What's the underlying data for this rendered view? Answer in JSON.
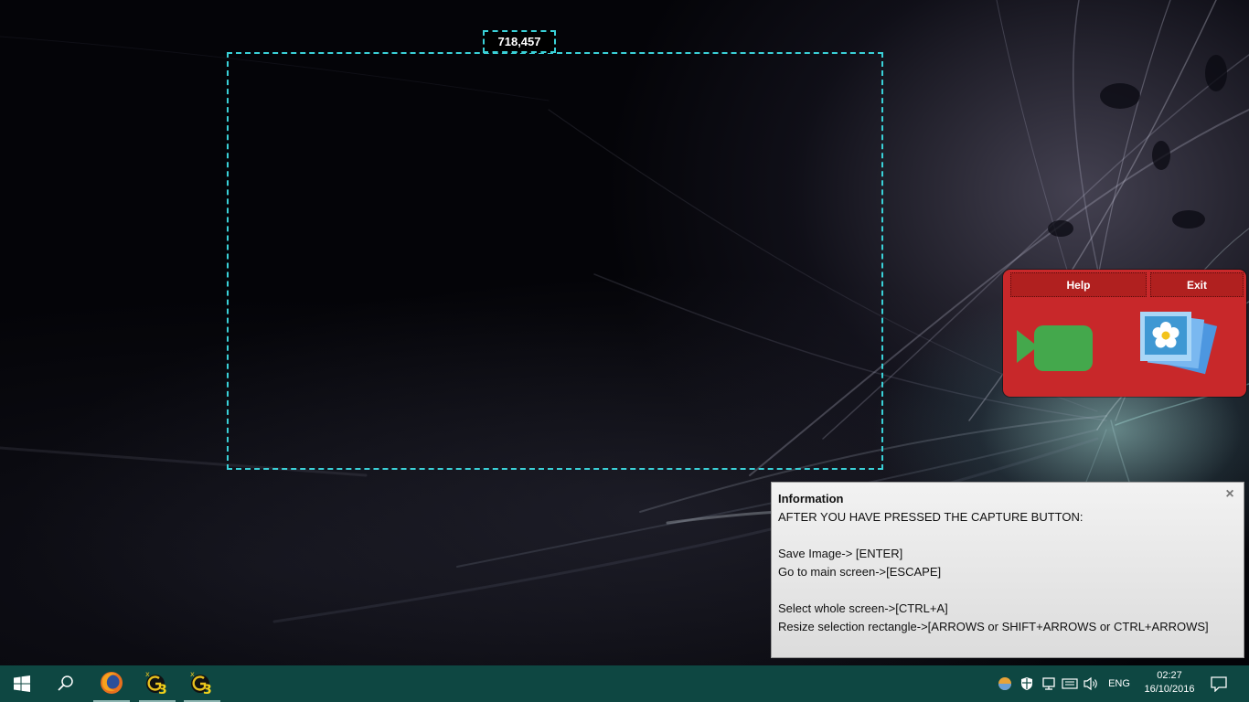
{
  "selection": {
    "size_label": "718,457",
    "border_color": "#3ad1d8"
  },
  "capture_panel": {
    "help_label": "Help",
    "exit_label": "Exit",
    "video_icon": "video-camera-icon",
    "image_icon": "image-gallery-icon",
    "background_color": "#c8282a"
  },
  "info_balloon": {
    "title": "Information",
    "close_icon": "close-icon",
    "lines": [
      "AFTER YOU HAVE PRESSED THE CAPTURE BUTTON:",
      "",
      "Save Image-> [ENTER]",
      "Go to main screen->[ESCAPE]",
      "",
      "Select whole screen->[CTRL+A]",
      "Resize selection rectangle->[ARROWS or SHIFT+ARROWS or CTRL+ARROWS]"
    ]
  },
  "taskbar": {
    "background_color": "#0e4742",
    "apps": [
      {
        "icon": "firefox-icon"
      },
      {
        "icon": "g3-app-icon"
      },
      {
        "icon": "g3-app-icon"
      }
    ],
    "language": "ENG",
    "clock": {
      "time": "02:27",
      "date": "16/10/2016"
    }
  }
}
